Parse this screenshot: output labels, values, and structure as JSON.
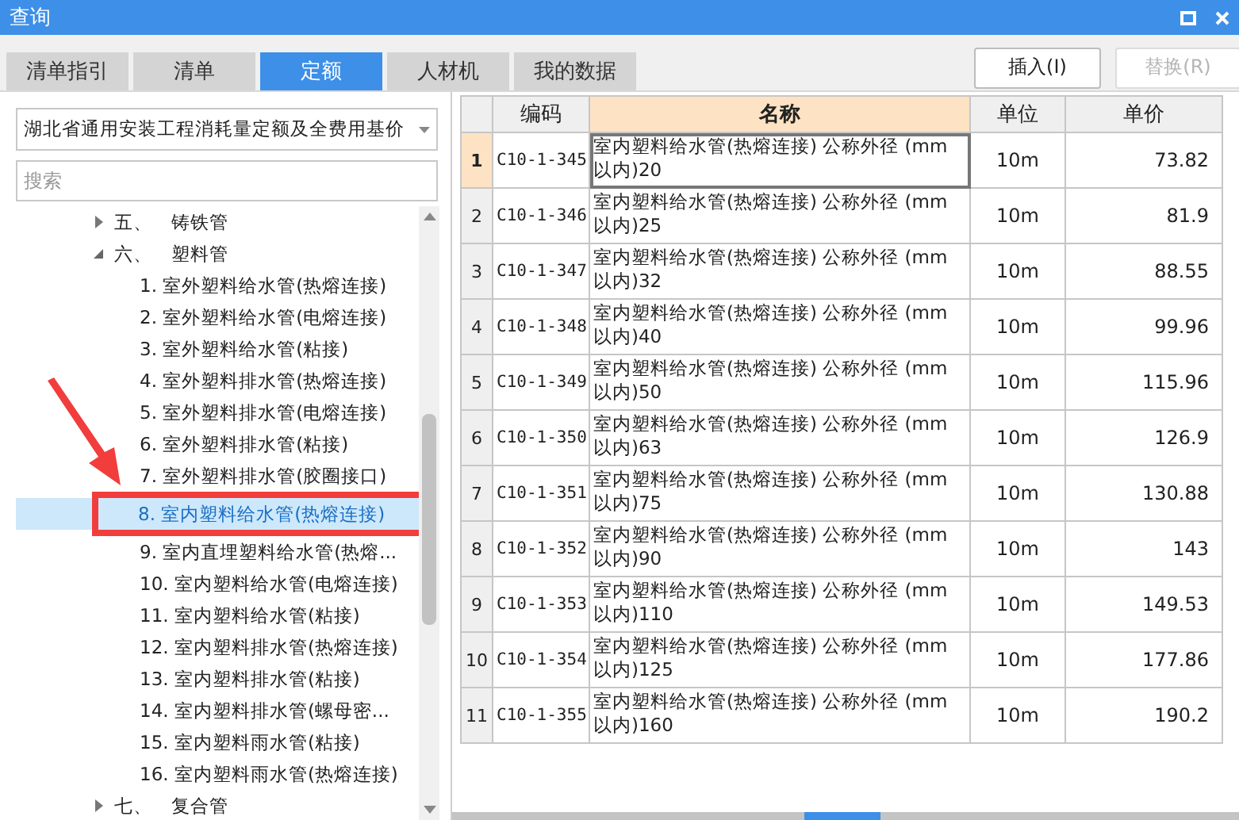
{
  "window": {
    "title": "查询"
  },
  "tabs": [
    {
      "label": "清单指引",
      "selected": false
    },
    {
      "label": "清单",
      "selected": false
    },
    {
      "label": "定额",
      "selected": true
    },
    {
      "label": "人材机",
      "selected": false
    },
    {
      "label": "我的数据",
      "selected": false
    }
  ],
  "buttons": [
    {
      "label": "插入(I)",
      "disabled": false
    },
    {
      "label": "替换(R)",
      "disabled": true
    }
  ],
  "library_select": {
    "value": "湖北省通用安装工程消耗量定额及全费用基价"
  },
  "search": {
    "placeholder": "搜索"
  },
  "tree": [
    {
      "number": "五、",
      "label": "铸铁管",
      "expanded": false
    },
    {
      "number": "六、",
      "label": "塑料管",
      "expanded": true,
      "children": [
        {
          "label": "1. 室外塑料给水管(热熔连接)",
          "selected": false
        },
        {
          "label": "2. 室外塑料给水管(电熔连接)",
          "selected": false
        },
        {
          "label": "3. 室外塑料给水管(粘接)",
          "selected": false
        },
        {
          "label": "4. 室外塑料排水管(热熔连接)",
          "selected": false
        },
        {
          "label": "5. 室外塑料排水管(电熔连接)",
          "selected": false
        },
        {
          "label": "6. 室外塑料排水管(粘接)",
          "selected": false
        },
        {
          "label": "7. 室外塑料排水管(胶圈接口)",
          "selected": false
        },
        {
          "label": "8. 室内塑料给水管(热熔连接)",
          "selected": true
        },
        {
          "label": "9. 室内直埋塑料给水管(热熔...",
          "selected": false
        },
        {
          "label": "10. 室内塑料给水管(电熔连接)",
          "selected": false
        },
        {
          "label": "11. 室内塑料给水管(粘接)",
          "selected": false
        },
        {
          "label": "12. 室内塑料排水管(热熔连接)",
          "selected": false
        },
        {
          "label": "13. 室内塑料排水管(粘接)",
          "selected": false
        },
        {
          "label": "14. 室内塑料排水管(螺母密...",
          "selected": false
        },
        {
          "label": "15. 室内塑料雨水管(粘接)",
          "selected": false
        },
        {
          "label": "16. 室内塑料雨水管(热熔连接)",
          "selected": false
        }
      ]
    },
    {
      "number": "七、",
      "label": "复合管",
      "expanded": false
    }
  ],
  "table": {
    "columns": [
      {
        "label": "编码",
        "selected": false
      },
      {
        "label": "名称",
        "selected": true
      },
      {
        "label": "单位",
        "selected": false
      },
      {
        "label": "单价",
        "selected": false
      }
    ],
    "rows": [
      {
        "index": "1",
        "code": "C10-1-345",
        "name": "室内塑料给水管(热熔连接) 公称外径 (mm以内)20",
        "unit": "10m",
        "price": "73.82",
        "selected": true
      },
      {
        "index": "2",
        "code": "C10-1-346",
        "name": "室内塑料给水管(热熔连接) 公称外径 (mm以内)25",
        "unit": "10m",
        "price": "81.9",
        "selected": false
      },
      {
        "index": "3",
        "code": "C10-1-347",
        "name": "室内塑料给水管(热熔连接) 公称外径 (mm以内)32",
        "unit": "10m",
        "price": "88.55",
        "selected": false
      },
      {
        "index": "4",
        "code": "C10-1-348",
        "name": "室内塑料给水管(热熔连接) 公称外径 (mm以内)40",
        "unit": "10m",
        "price": "99.96",
        "selected": false
      },
      {
        "index": "5",
        "code": "C10-1-349",
        "name": "室内塑料给水管(热熔连接) 公称外径 (mm以内)50",
        "unit": "10m",
        "price": "115.96",
        "selected": false
      },
      {
        "index": "6",
        "code": "C10-1-350",
        "name": "室内塑料给水管(热熔连接) 公称外径 (mm以内)63",
        "unit": "10m",
        "price": "126.9",
        "selected": false
      },
      {
        "index": "7",
        "code": "C10-1-351",
        "name": "室内塑料给水管(热熔连接) 公称外径 (mm以内)75",
        "unit": "10m",
        "price": "130.88",
        "selected": false
      },
      {
        "index": "8",
        "code": "C10-1-352",
        "name": "室内塑料给水管(热熔连接) 公称外径 (mm以内)90",
        "unit": "10m",
        "price": "143",
        "selected": false
      },
      {
        "index": "9",
        "code": "C10-1-353",
        "name": "室内塑料给水管(热熔连接) 公称外径 (mm以内)110",
        "unit": "10m",
        "price": "149.53",
        "selected": false
      },
      {
        "index": "10",
        "code": "C10-1-354",
        "name": "室内塑料给水管(热熔连接) 公称外径 (mm以内)125",
        "unit": "10m",
        "price": "177.86",
        "selected": false
      },
      {
        "index": "11",
        "code": "C10-1-355",
        "name": "室内塑料给水管(热熔连接) 公称外径 (mm以内)160",
        "unit": "10m",
        "price": "190.2",
        "selected": false
      }
    ]
  }
}
